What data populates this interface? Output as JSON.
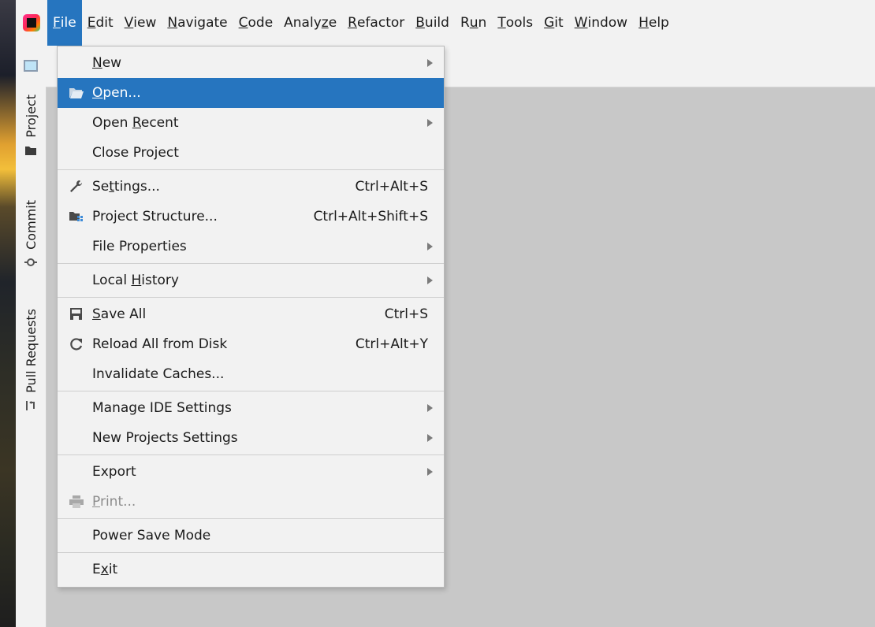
{
  "menubar": {
    "items": [
      {
        "pre": "",
        "mn": "F",
        "post": "ile",
        "active": true
      },
      {
        "pre": "",
        "mn": "E",
        "post": "dit"
      },
      {
        "pre": "",
        "mn": "V",
        "post": "iew"
      },
      {
        "pre": "",
        "mn": "N",
        "post": "avigate"
      },
      {
        "pre": "",
        "mn": "C",
        "post": "ode"
      },
      {
        "pre": "Analy",
        "mn": "z",
        "post": "e"
      },
      {
        "pre": "",
        "mn": "R",
        "post": "efactor"
      },
      {
        "pre": "",
        "mn": "B",
        "post": "uild"
      },
      {
        "pre": "R",
        "mn": "u",
        "post": "n"
      },
      {
        "pre": "",
        "mn": "T",
        "post": "ools"
      },
      {
        "pre": "",
        "mn": "G",
        "post": "it"
      },
      {
        "pre": "",
        "mn": "W",
        "post": "indow"
      },
      {
        "pre": "",
        "mn": "H",
        "post": "elp"
      }
    ]
  },
  "tool_windows": {
    "project": "Project",
    "commit": "Commit",
    "pull_requests": "Pull Requests"
  },
  "file_menu": {
    "new": {
      "pre": "",
      "mn": "N",
      "post": "ew"
    },
    "open": {
      "pre": "",
      "mn": "O",
      "post": "pen..."
    },
    "open_recent": {
      "pre": "Open ",
      "mn": "R",
      "post": "ecent"
    },
    "close_project": {
      "pre": "Close Project",
      "mn": "",
      "post": ""
    },
    "settings": {
      "pre": "Se",
      "mn": "t",
      "post": "tings...",
      "shortcut": "Ctrl+Alt+S"
    },
    "project_structure": {
      "pre": "Project Structure...",
      "mn": "",
      "post": "",
      "shortcut": "Ctrl+Alt+Shift+S"
    },
    "file_properties": {
      "pre": "File Properties",
      "mn": "",
      "post": ""
    },
    "local_history": {
      "pre": "Local ",
      "mn": "H",
      "post": "istory"
    },
    "save_all": {
      "pre": "",
      "mn": "S",
      "post": "ave All",
      "shortcut": "Ctrl+S"
    },
    "reload_all": {
      "pre": "Reload All from Disk",
      "mn": "",
      "post": "",
      "shortcut": "Ctrl+Alt+Y"
    },
    "invalidate_caches": {
      "pre": "Invalidate Caches...",
      "mn": "",
      "post": ""
    },
    "manage_ide_settings": {
      "pre": "Manage IDE Settings",
      "mn": "",
      "post": ""
    },
    "new_projects_settings": {
      "pre": "New Projects Settings",
      "mn": "",
      "post": ""
    },
    "export": {
      "pre": "Export",
      "mn": "",
      "post": ""
    },
    "print": {
      "pre": "",
      "mn": "P",
      "post": "rint..."
    },
    "power_save_mode": {
      "pre": "Power Save Mode",
      "mn": "",
      "post": ""
    },
    "exit": {
      "pre": "E",
      "mn": "x",
      "post": "it"
    }
  },
  "colors": {
    "selection": "#2675bf",
    "menu_bg": "#f2f2f2",
    "editor_bg": "#c8c8c8"
  },
  "icons": {
    "open": "folder-open-icon",
    "settings": "wrench-icon",
    "project_structure": "project-structure-icon",
    "save_all": "save-icon",
    "reload": "reload-icon",
    "print": "printer-icon"
  }
}
